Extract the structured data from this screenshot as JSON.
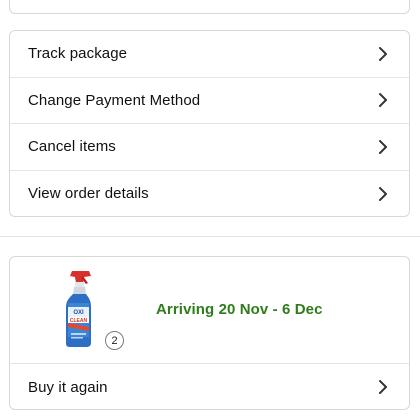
{
  "actions": {
    "items": [
      {
        "label": "Track package",
        "icon": "chevron-right-icon"
      },
      {
        "label": "Change Payment Method",
        "icon": "chevron-right-icon"
      },
      {
        "label": "Cancel items",
        "icon": "chevron-right-icon"
      },
      {
        "label": "View order details",
        "icon": "chevron-right-icon"
      }
    ]
  },
  "shipment": {
    "arriving": "Arriving 20 Nov - 6 Dec",
    "quantity": "2",
    "product_image": "oxiclean-spray-bottle",
    "buy_again_label": "Buy it again"
  },
  "colors": {
    "arriving_green": "#2e7d1a",
    "border": "#d5d9d9",
    "divider": "#e3e6e6"
  }
}
